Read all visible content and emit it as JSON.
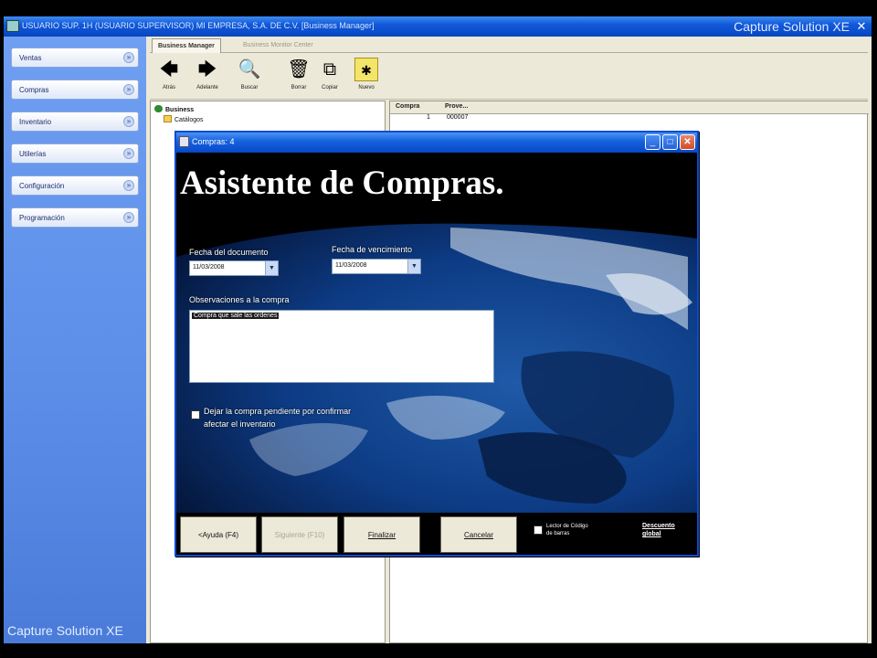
{
  "window": {
    "title": "USUARIO SUP. 1H (USUARIO SUPERVISOR)    MI EMPRESA, S.A. DE C.V.  [Business Manager]",
    "brand": "Capture Solution XE",
    "close_glyph": "✕"
  },
  "sidebar": {
    "items": [
      {
        "label": "Ventas",
        "chev": "»"
      },
      {
        "label": "Compras",
        "chev": "»"
      },
      {
        "label": "Inventario",
        "chev": "»"
      },
      {
        "label": "Utilerías",
        "chev": "»"
      },
      {
        "label": "Configuración",
        "chev": "»"
      },
      {
        "label": "Programación",
        "chev": "»"
      }
    ],
    "footer": "Capture Solution XE"
  },
  "tabs": [
    {
      "label": "Business Manager",
      "active": true
    },
    {
      "label": "Business Monitor Center",
      "active": false
    }
  ],
  "toolbar": [
    {
      "label": "Atrás",
      "icon": "arrow-left-icon",
      "glyph": "🡄"
    },
    {
      "label": "Adelante",
      "icon": "arrow-right-icon",
      "glyph": "🡆"
    },
    {
      "label": "Buscar",
      "icon": "search-icon",
      "glyph": "🔍"
    },
    {
      "label": "Borrar",
      "icon": "delete-icon",
      "glyph": "🗑"
    },
    {
      "label": "Copiar",
      "icon": "copy-icon",
      "glyph": "⧉"
    },
    {
      "label": "Nuevo",
      "icon": "new-icon",
      "glyph": "✱"
    }
  ],
  "tree": {
    "root": "Business",
    "child": "Catálogos"
  },
  "grid": {
    "columns": [
      "Compra",
      "Prove..."
    ],
    "rows": [
      [
        "1",
        "000007"
      ]
    ]
  },
  "dialog": {
    "title": "Compras: 4",
    "heading": "Asistente de Compras.",
    "fecha_documento_label": "Fecha del documento",
    "fecha_documento_value": "11/03/2008",
    "fecha_vencimiento_label": "Fecha de vencimiento",
    "fecha_vencimiento_value": "11/03/2008",
    "observaciones_label": "Observaciones a la compra",
    "observaciones_hint": "Compra que sale las ordenes",
    "pendiente_label_1": "Dejar la compra pendiente por confirmar",
    "pendiente_label_2": "afectar el inventario",
    "buttons": {
      "ayuda": "<Ayuda (F4)",
      "siguiente": "Siguiente (F10)",
      "finalizar": "Finalizar",
      "cancelar": "Cancelar"
    },
    "lector_label_1": "Lector de Código",
    "lector_label_2": "de barras",
    "descuento_1": "Descuento",
    "descuento_2": "global",
    "dropdown_glyph": "▼",
    "minimize_glyph": "_",
    "maximize_glyph": "□",
    "close_glyph": "✕"
  },
  "colors": {
    "titlebar": "#0b4fcf",
    "sidebar": "#5b8de8",
    "dialog_banner": "#000000"
  }
}
